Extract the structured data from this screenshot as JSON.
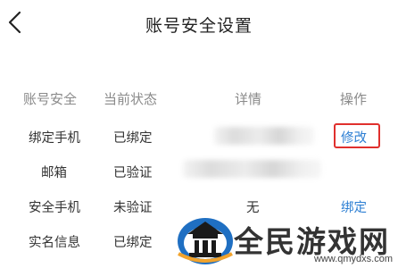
{
  "header": {
    "title": "账号安全设置",
    "back_icon": "chevron-left-icon"
  },
  "table": {
    "columns": [
      "账号安全",
      "当前状态",
      "详情",
      "操作"
    ],
    "rows": [
      {
        "type": "绑定手机",
        "status": "已绑定",
        "detail": "",
        "action": "修改"
      },
      {
        "type": "邮箱",
        "status": "已验证",
        "detail": "",
        "action": ""
      },
      {
        "type": "安全手机",
        "status": "未验证",
        "detail": "无",
        "action": "绑定"
      },
      {
        "type": "实名信息",
        "status": "已绑定",
        "detail": "",
        "action": ""
      }
    ]
  },
  "watermark": {
    "name": "全民游戏网",
    "url": "www.qmydxs.com"
  },
  "colors": {
    "link": "#2d7fd3",
    "highlight": "#e0302d",
    "header_text": "#8a8a8a"
  }
}
